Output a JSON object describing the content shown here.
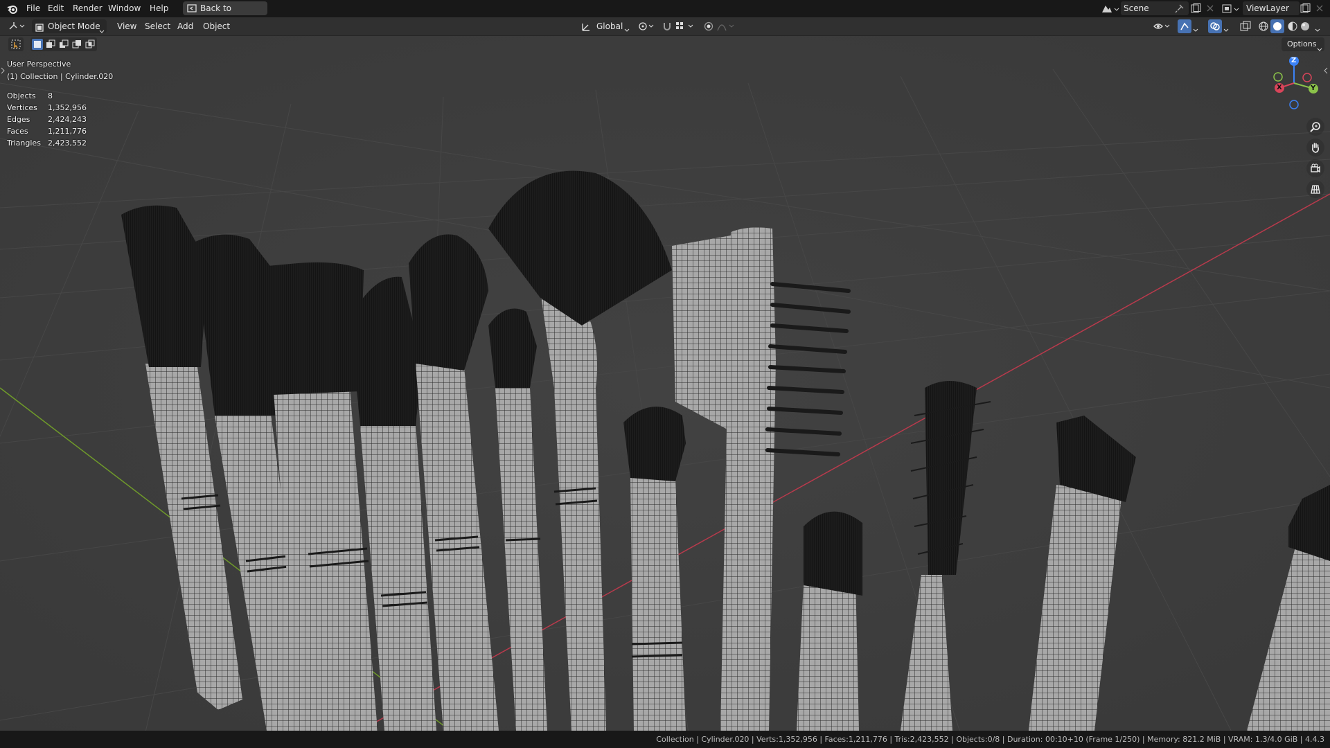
{
  "menu": {
    "file": "File",
    "edit": "Edit",
    "render": "Render",
    "window": "Window",
    "help": "Help",
    "back": "Back to Previous"
  },
  "topright": {
    "scene": "Scene",
    "view_layer": "ViewLayer"
  },
  "header": {
    "mode": "Object Mode",
    "view": "View",
    "select": "Select",
    "add": "Add",
    "object": "Object",
    "transform_orientation": "Global",
    "options": "Options"
  },
  "viewport": {
    "perspective": "User Perspective",
    "collection": "(1) Collection | Cylinder.020",
    "stats": [
      {
        "label": "Objects",
        "value": "8"
      },
      {
        "label": "Vertices",
        "value": "1,352,956"
      },
      {
        "label": "Edges",
        "value": "2,424,243"
      },
      {
        "label": "Faces",
        "value": "1,211,776"
      },
      {
        "label": "Triangles",
        "value": "2,423,552"
      }
    ],
    "gizmo": {
      "x": "X",
      "y": "Y",
      "z": "Z"
    }
  },
  "statusbar": {
    "text": "Collection | Cylinder.020 | Verts:1,352,956 | Faces:1,211,776 | Tris:2,423,552 | Objects:0/8 | Duration: 00:10+10 (Frame 1/250) | Memory: 821.2 MiB | VRAM: 1.3/4.0 GiB | 4.4.3"
  },
  "colors": {
    "viewport_bg": "#3d3d3d",
    "axis_x": "#d8455a",
    "axis_y": "#8bc34a",
    "axis_z": "#3b82f6",
    "active_blue": "#4772b3"
  }
}
